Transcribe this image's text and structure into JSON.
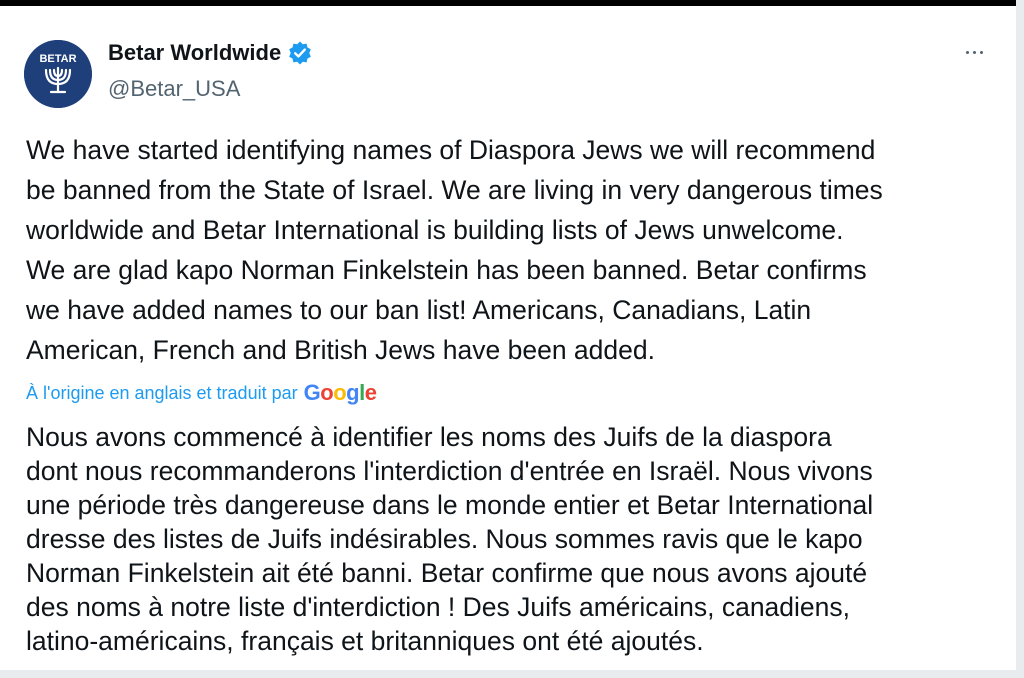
{
  "account": {
    "display_name": "Betar Worldwide",
    "handle": "@Betar_USA",
    "avatar_text": "BETAR",
    "verified": true
  },
  "tweet": {
    "text": "We have started identifying names of Diaspora Jews we will recommend\nbe banned from the State of Israel. We are living in very dangerous times\nworldwide and Betar International is building lists of Jews unwelcome.\nWe are glad kapo Norman Finkelstein has been banned. Betar confirms\nwe have added names to our ban list! Americans, Canadians, Latin\nAmerican, French and British Jews have been added.",
    "translation_note": "À l'origine en anglais et traduit par",
    "translator": {
      "letters": [
        "G",
        "o",
        "o",
        "g",
        "l",
        "e"
      ],
      "colors": [
        "#4285F4",
        "#EA4335",
        "#FBBC05",
        "#4285F4",
        "#34A853",
        "#EA4335"
      ]
    },
    "translated_text": "Nous avons commencé à identifier les noms des Juifs de la diaspora\ndont nous recommanderons l'interdiction d'entrée en Israël. Nous vivons\nune période très dangereuse dans le monde entier et Betar International\ndresse des listes de Juifs indésirables. Nous sommes ravis que le kapo\nNorman Finkelstein ait été banni. Betar confirme que nous avons ajouté\ndes noms à notre liste d'interdiction ! Des Juifs américains, canadiens,\nlatino-américains, français et britanniques ont été ajoutés."
  },
  "icons": {
    "verified": "verified-badge-icon",
    "more": "more-options-icon"
  },
  "colors": {
    "link": "#1d9bf0",
    "secondary_text": "#536471",
    "avatar_bg": "#1f3f7a"
  }
}
